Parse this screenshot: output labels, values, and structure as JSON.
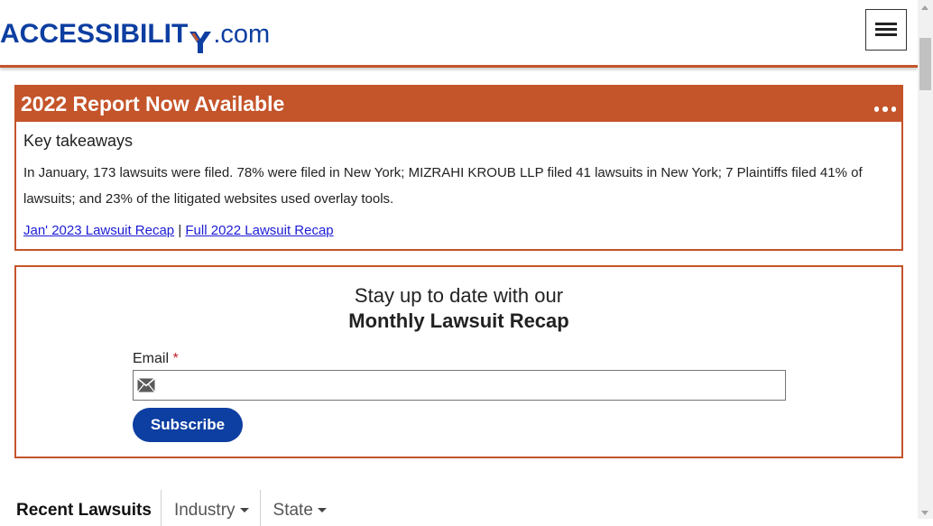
{
  "header": {
    "logo_main": "ACCESSIBILIT",
    "logo_suffix": ".com",
    "menu_icon": "hamburger-menu-icon"
  },
  "report": {
    "title": "2022 Report Now Available",
    "more_icon": "more-dots-icon",
    "subtitle": "Key takeaways",
    "text": "In January, 173 lawsuits were filed. 78% were filed in New York; MIZRAHI KROUB LLP filed 41 lawsuits in New York; 7 Plaintiffs filed 41% of lawsuits; and 23% of the litigated websites used overlay tools.",
    "link1": "Jan' 2023 Lawsuit Recap",
    "separator": "|",
    "link2": "Full 2022 Lawsuit Recap"
  },
  "subscribe": {
    "line1": "Stay up to date with our",
    "line2": "Monthly Lawsuit Recap",
    "email_label": "Email",
    "required_mark": "*",
    "email_value": "",
    "email_icon": "envelope-icon",
    "button_label": "Subscribe"
  },
  "tabs": [
    {
      "label": "Recent Lawsuits"
    },
    {
      "label": "Industry"
    },
    {
      "label": "State"
    }
  ],
  "colors": {
    "brand_blue": "#0d3ea1",
    "accent_orange": "#c4542a"
  }
}
